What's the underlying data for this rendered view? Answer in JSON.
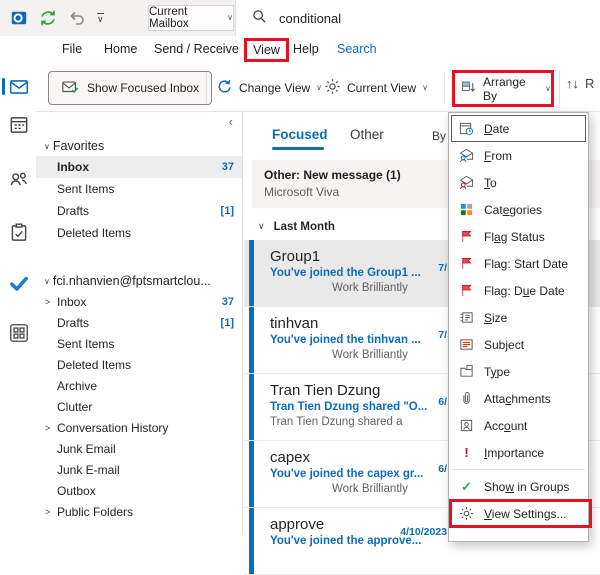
{
  "titlebar": {
    "mailbox_dropdown": "Current Mailbox",
    "search_value": "conditional"
  },
  "tabs": [
    "File",
    "Home",
    "Send / Receive",
    "View",
    "Help",
    "Search"
  ],
  "ribbon": {
    "show_focused_inbox": "Show Focused Inbox",
    "change_view": "Change View",
    "current_view": "Current View",
    "arrange_by": "Arrange By",
    "reverse_sort_partial": "R"
  },
  "folder_pane": {
    "favorites_label": "Favorites",
    "favorites": [
      {
        "name": "Inbox",
        "count": "37"
      },
      {
        "name": "Sent Items",
        "count": ""
      },
      {
        "name": "Drafts",
        "count": "[1]"
      },
      {
        "name": "Deleted Items",
        "count": ""
      }
    ],
    "account_label": "fci.nhanvien@fptsmartclou...",
    "folders": [
      {
        "expander": ">",
        "name": "Inbox",
        "count": "37"
      },
      {
        "expander": "",
        "name": "Drafts",
        "count": "[1]"
      },
      {
        "expander": "",
        "name": "Sent Items",
        "count": ""
      },
      {
        "expander": "",
        "name": "Deleted Items",
        "count": ""
      },
      {
        "expander": "",
        "name": "Archive",
        "count": ""
      },
      {
        "expander": "",
        "name": "Clutter",
        "count": ""
      },
      {
        "expander": ">",
        "name": "Conversation History",
        "count": ""
      },
      {
        "expander": "",
        "name": "Junk Email",
        "count": ""
      },
      {
        "expander": "",
        "name": "Junk E-mail",
        "count": ""
      },
      {
        "expander": "",
        "name": "Outbox",
        "count": ""
      },
      {
        "expander": ">",
        "name": "Public Folders",
        "count": ""
      }
    ]
  },
  "message_list": {
    "tab_focused": "Focused",
    "tab_other": "Other",
    "sort_by_label": "By",
    "banner_title": "Other: New message (1)",
    "banner_source": "Microsoft Viva",
    "group_header": "Last Month",
    "messages": [
      {
        "sender": "Group1",
        "subject": "You've joined the Group1 ...",
        "preview": "Work Brilliantly",
        "date": "7/"
      },
      {
        "sender": "tinhvan",
        "subject": "You've joined the tinhvan ...",
        "preview": "Work Brilliantly",
        "date": "7/"
      },
      {
        "sender": "Tran Tien Dzung",
        "subject": "Tran Tien Dzung shared \"O...",
        "preview": "Tran Tien Dzung shared a",
        "date": "6/"
      },
      {
        "sender": "capex",
        "subject": "You've joined the capex gr...",
        "preview": "Work Brilliantly",
        "date": "6/"
      },
      {
        "sender": "approve",
        "subject": "You've joined the approve...",
        "preview": "",
        "date": "4/10/2023"
      }
    ]
  },
  "arrange_menu": {
    "items": [
      {
        "pre": "",
        "key": "D",
        "post": "ate"
      },
      {
        "pre": "",
        "key": "F",
        "post": "rom"
      },
      {
        "pre": "",
        "key": "T",
        "post": "o"
      },
      {
        "pre": "Cat",
        "key": "e",
        "post": "gories"
      },
      {
        "pre": "Fl",
        "key": "a",
        "post": "g Status"
      },
      {
        "pre": "Fla",
        "key": "g",
        "post": ": Start Date"
      },
      {
        "pre": "Flag: D",
        "key": "u",
        "post": "e Date"
      },
      {
        "pre": "",
        "key": "S",
        "post": "ize"
      },
      {
        "pre": "Sub",
        "key": "j",
        "post": "ect"
      },
      {
        "pre": "T",
        "key": "y",
        "post": "pe"
      },
      {
        "pre": "Atta",
        "key": "c",
        "post": "hments"
      },
      {
        "pre": "Acc",
        "key": "o",
        "post": "unt"
      },
      {
        "pre": "",
        "key": "I",
        "post": "mportance"
      },
      {
        "pre": "Sho",
        "key": "w",
        "post": " in Groups"
      },
      {
        "pre": "",
        "key": "V",
        "post": "iew Settings..."
      }
    ]
  },
  "icons": {
    "caret_down": "∨",
    "chevron_collapsed": ">",
    "chevron_expanded": "∨",
    "pane_collapse": "‹",
    "importance_exclamation": "!",
    "group_check": "✓",
    "reverse_sort_arrows": "↑↓"
  },
  "colors": {
    "accent_blue": "#0f6cbd",
    "highlight_red": "#e81123",
    "flag_red": "#c50f1f",
    "check_green": "#3aa655",
    "titlebar_gray": "#f3f2f1"
  }
}
